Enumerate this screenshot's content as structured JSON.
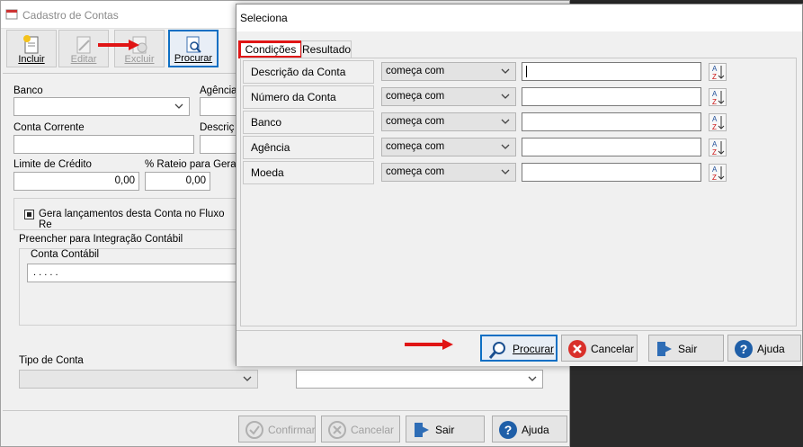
{
  "background_window": {
    "title": "Cadastro de Contas",
    "toolbar": [
      {
        "label": "Incluir",
        "enabled": true,
        "icon": "new-document-icon"
      },
      {
        "label": "Editar",
        "enabled": false,
        "icon": "edit-icon"
      },
      {
        "label": "Excluir",
        "enabled": false,
        "icon": "delete-icon"
      },
      {
        "label": "Procurar",
        "enabled": true,
        "icon": "search-document-icon"
      }
    ],
    "fields": {
      "banco_label": "Banco",
      "agencia_label": "Agência",
      "conta_corrente_label": "Conta Corrente",
      "descricao_label": "Descriç",
      "limite_label": "Limite de Crédito",
      "limite_value": "0,00",
      "rateio_label": "% Rateio para Geraç",
      "rateio_value": "0,00",
      "fluxo_checkbox_label": "Gera lançamentos desta Conta no Fluxo Re",
      "integracao_group_label": "Preencher para Integração Contábil",
      "conta_contabil_label": "Conta Contábil",
      "conta_contabil_value": ". . . . .",
      "tipo_conta_label": "Tipo de Conta"
    },
    "buttons": {
      "confirmar": "Confirmar",
      "cancelar": "Cancelar",
      "sair": "Sair",
      "ajuda": "Ajuda"
    }
  },
  "dialog": {
    "title": "Seleciona",
    "tabs": [
      "Condições",
      "Resultado"
    ],
    "active_tab": "Condições",
    "conditions": [
      {
        "field": "Descrição da Conta",
        "operator": "começa com",
        "value": ""
      },
      {
        "field": "Número da Conta",
        "operator": "começa com",
        "value": ""
      },
      {
        "field": "Banco",
        "operator": "começa com",
        "value": ""
      },
      {
        "field": "Agência",
        "operator": "começa com",
        "value": ""
      },
      {
        "field": "Moeda",
        "operator": "começa com",
        "value": ""
      }
    ],
    "buttons": {
      "procurar": "Procurar",
      "cancelar": "Cancelar",
      "sair": "Sair",
      "ajuda": "Ajuda"
    }
  },
  "colors": {
    "highlight_red": "#e01515",
    "selected_blue": "#0d6fc4",
    "cancel_red": "#d9302a",
    "help_blue": "#1f5fa8"
  }
}
